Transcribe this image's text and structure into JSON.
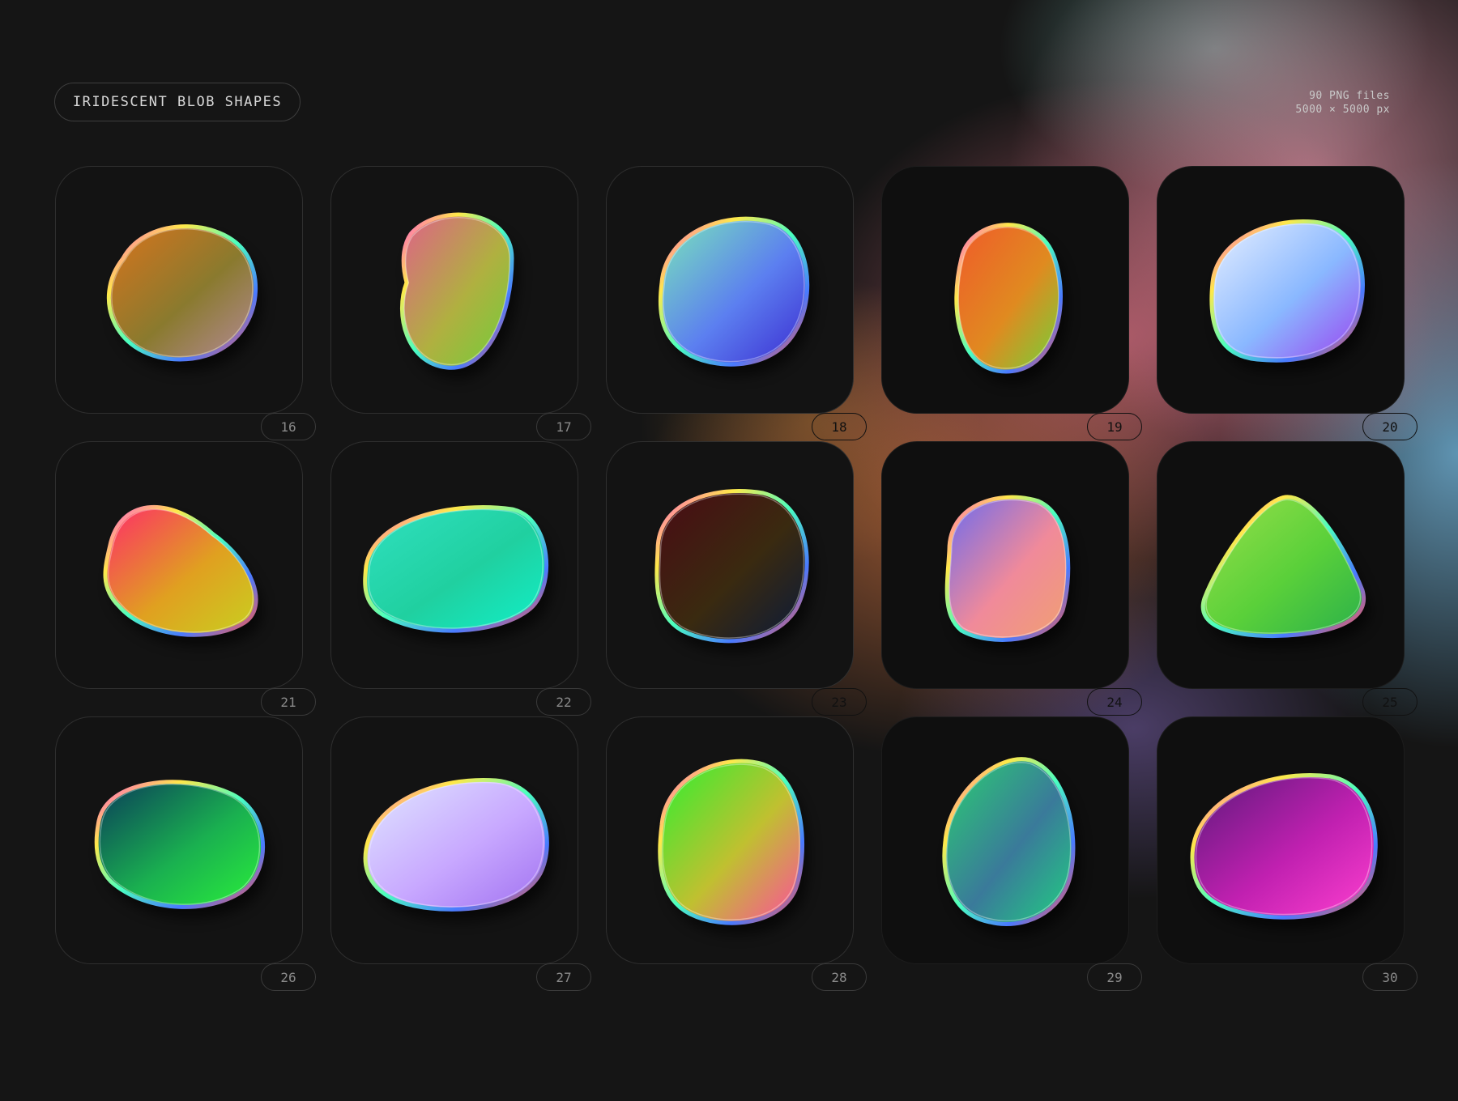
{
  "header": {
    "title": "IRIDESCENT BLOB SHAPES",
    "meta_line1": "90 PNG files",
    "meta_line2": "5000 × 5000 px"
  },
  "cards": [
    {
      "number": "16",
      "colors": [
        "#d9731c",
        "#8a7a2e",
        "#b58a9a"
      ]
    },
    {
      "number": "17",
      "colors": [
        "#e0608a",
        "#b0b040",
        "#6ecf3a"
      ]
    },
    {
      "number": "18",
      "colors": [
        "#7ae8b8",
        "#5c7ff0",
        "#3a2ad0"
      ]
    },
    {
      "number": "19",
      "colors": [
        "#f05a2a",
        "#e08a20",
        "#6ed43a"
      ]
    },
    {
      "number": "20",
      "colors": [
        "#e8f0ff",
        "#8ab8ff",
        "#9a40f0"
      ]
    },
    {
      "number": "21",
      "colors": [
        "#ff2a6a",
        "#e0a020",
        "#c8d020"
      ]
    },
    {
      "number": "22",
      "colors": [
        "#30e0c0",
        "#20d0a0",
        "#10f0c8"
      ]
    },
    {
      "number": "23",
      "colors": [
        "#4a0a14",
        "#3a2a10",
        "#0a1a3a"
      ]
    },
    {
      "number": "24",
      "colors": [
        "#6a6af0",
        "#f08a9a",
        "#f0a070"
      ]
    },
    {
      "number": "25",
      "colors": [
        "#9ae04a",
        "#5ad03a",
        "#2ab04a"
      ]
    },
    {
      "number": "26",
      "colors": [
        "#0a3a5a",
        "#1ab050",
        "#2af03a"
      ]
    },
    {
      "number": "27",
      "colors": [
        "#e0e8ff",
        "#c8a8ff",
        "#a070f0"
      ]
    },
    {
      "number": "28",
      "colors": [
        "#2af030",
        "#c0c030",
        "#ff4aa0"
      ]
    },
    {
      "number": "29",
      "colors": [
        "#2ad070",
        "#3a7a9a",
        "#20d080"
      ]
    },
    {
      "number": "30",
      "colors": [
        "#5a1a7a",
        "#c020b0",
        "#ff40d0"
      ]
    }
  ]
}
